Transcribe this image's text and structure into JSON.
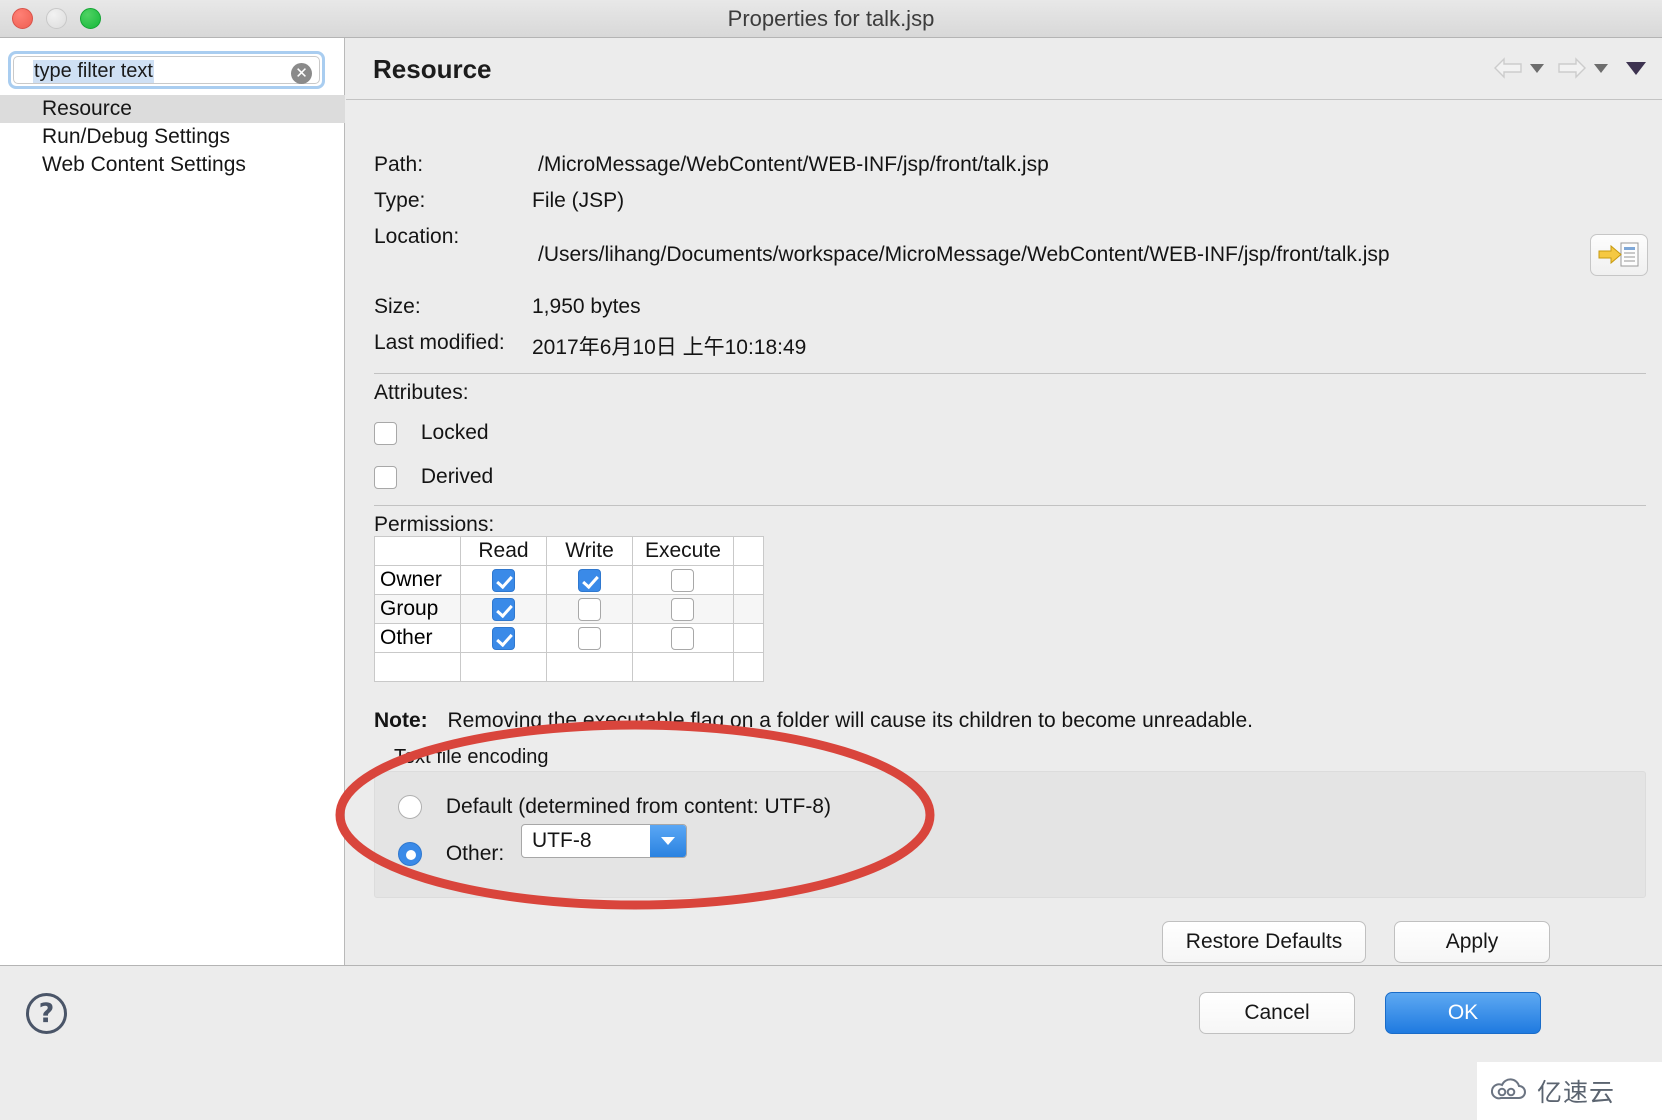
{
  "window": {
    "title": "Properties for talk.jsp",
    "traffic_lights": [
      "close-red",
      "minimize-gray",
      "zoom-green"
    ]
  },
  "sidebar": {
    "filter": {
      "value": "type filter text",
      "placeholder": "type filter text",
      "clear_icon": "clear-circle-icon"
    },
    "items": [
      {
        "label": "Resource",
        "selected": true
      },
      {
        "label": "Run/Debug Settings",
        "selected": false
      },
      {
        "label": "Web Content Settings",
        "selected": false
      }
    ]
  },
  "header": {
    "title": "Resource",
    "back_icon": "back-arrow-icon",
    "forward_icon": "forward-arrow-icon",
    "menu_icon": "chevron-down-icon"
  },
  "resource": {
    "path_label": "Path:",
    "path_value": "/MicroMessage/WebContent/WEB-INF/jsp/front/talk.jsp",
    "type_label": "Type:",
    "type_value": "File  (JSP)",
    "location_label": "Location:",
    "location_value": "/Users/lihang/Documents/workspace/MicroMessage/WebContent/WEB-INF/jsp/front/talk.jsp",
    "reveal_icon": "reveal-in-finder-icon",
    "size_label": "Size:",
    "size_value": "1,950  bytes",
    "modified_label": "Last modified:",
    "modified_value": "2017年6月10日 上午10:18:49"
  },
  "attributes": {
    "heading": "Attributes:",
    "items": [
      {
        "label": "Locked",
        "checked": false
      },
      {
        "label": "Derived",
        "checked": false
      }
    ]
  },
  "permissions": {
    "heading": "Permissions:",
    "columns": [
      "",
      "Read",
      "Write",
      "Execute"
    ],
    "rows": [
      {
        "name": "Owner",
        "read": true,
        "write": true,
        "execute": false
      },
      {
        "name": "Group",
        "read": true,
        "write": false,
        "execute": false
      },
      {
        "name": "Other",
        "read": true,
        "write": false,
        "execute": false
      }
    ],
    "note_label": "Note:",
    "note_text": "Removing the executable flag on a folder will cause its children to become unreadable."
  },
  "encoding": {
    "group_label": "Text file encoding",
    "default_option": "Default (determined from content: UTF-8)",
    "default_selected": false,
    "other_label": "Other:",
    "other_selected": true,
    "other_value": "UTF-8",
    "dropdown_icon": "chevron-down-icon"
  },
  "buttons": {
    "restore_defaults": "Restore Defaults",
    "apply": "Apply",
    "cancel": "Cancel",
    "ok": "OK",
    "help_icon": "question-mark-icon"
  },
  "annotation": {
    "shape": "ellipse",
    "color": "#d9453c"
  },
  "watermark": {
    "text": "亿速云",
    "logo_icon": "cloud-logo-icon"
  }
}
